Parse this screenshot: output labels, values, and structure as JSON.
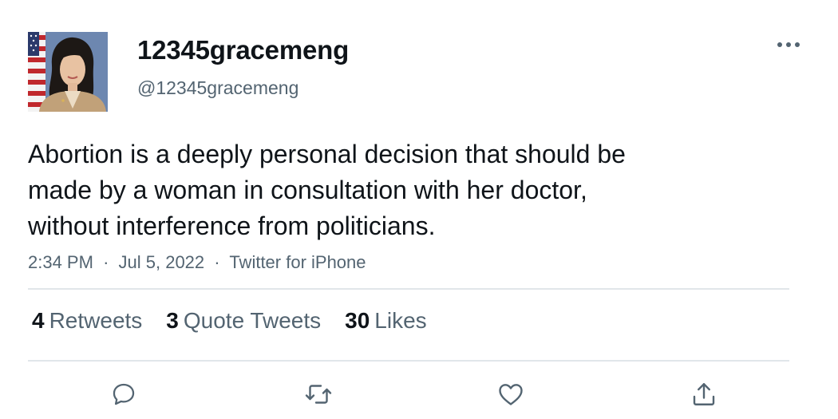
{
  "user": {
    "display_name": "12345gracemeng",
    "handle": "@12345gracemeng"
  },
  "tweet": {
    "lines": [
      "Abortion is a deeply personal decision that should be",
      "made by a woman in consultation with her doctor,",
      "without interference from politicians."
    ],
    "time": "2:34 PM",
    "date": "Jul 5, 2022",
    "source": "Twitter for iPhone",
    "separator": "·"
  },
  "stats": {
    "retweets": {
      "count": "4",
      "label": "Retweets"
    },
    "quotes": {
      "count": "3",
      "label": "Quote Tweets"
    },
    "likes": {
      "count": "30",
      "label": "Likes"
    }
  },
  "icons": {
    "more": "more-horizontal-icon",
    "reply": "reply-icon",
    "retweet": "retweet-icon",
    "like": "heart-icon",
    "share": "share-icon"
  },
  "colors": {
    "text_primary": "#0f1419",
    "text_secondary": "#536471",
    "divider": "#e1e6ea"
  }
}
